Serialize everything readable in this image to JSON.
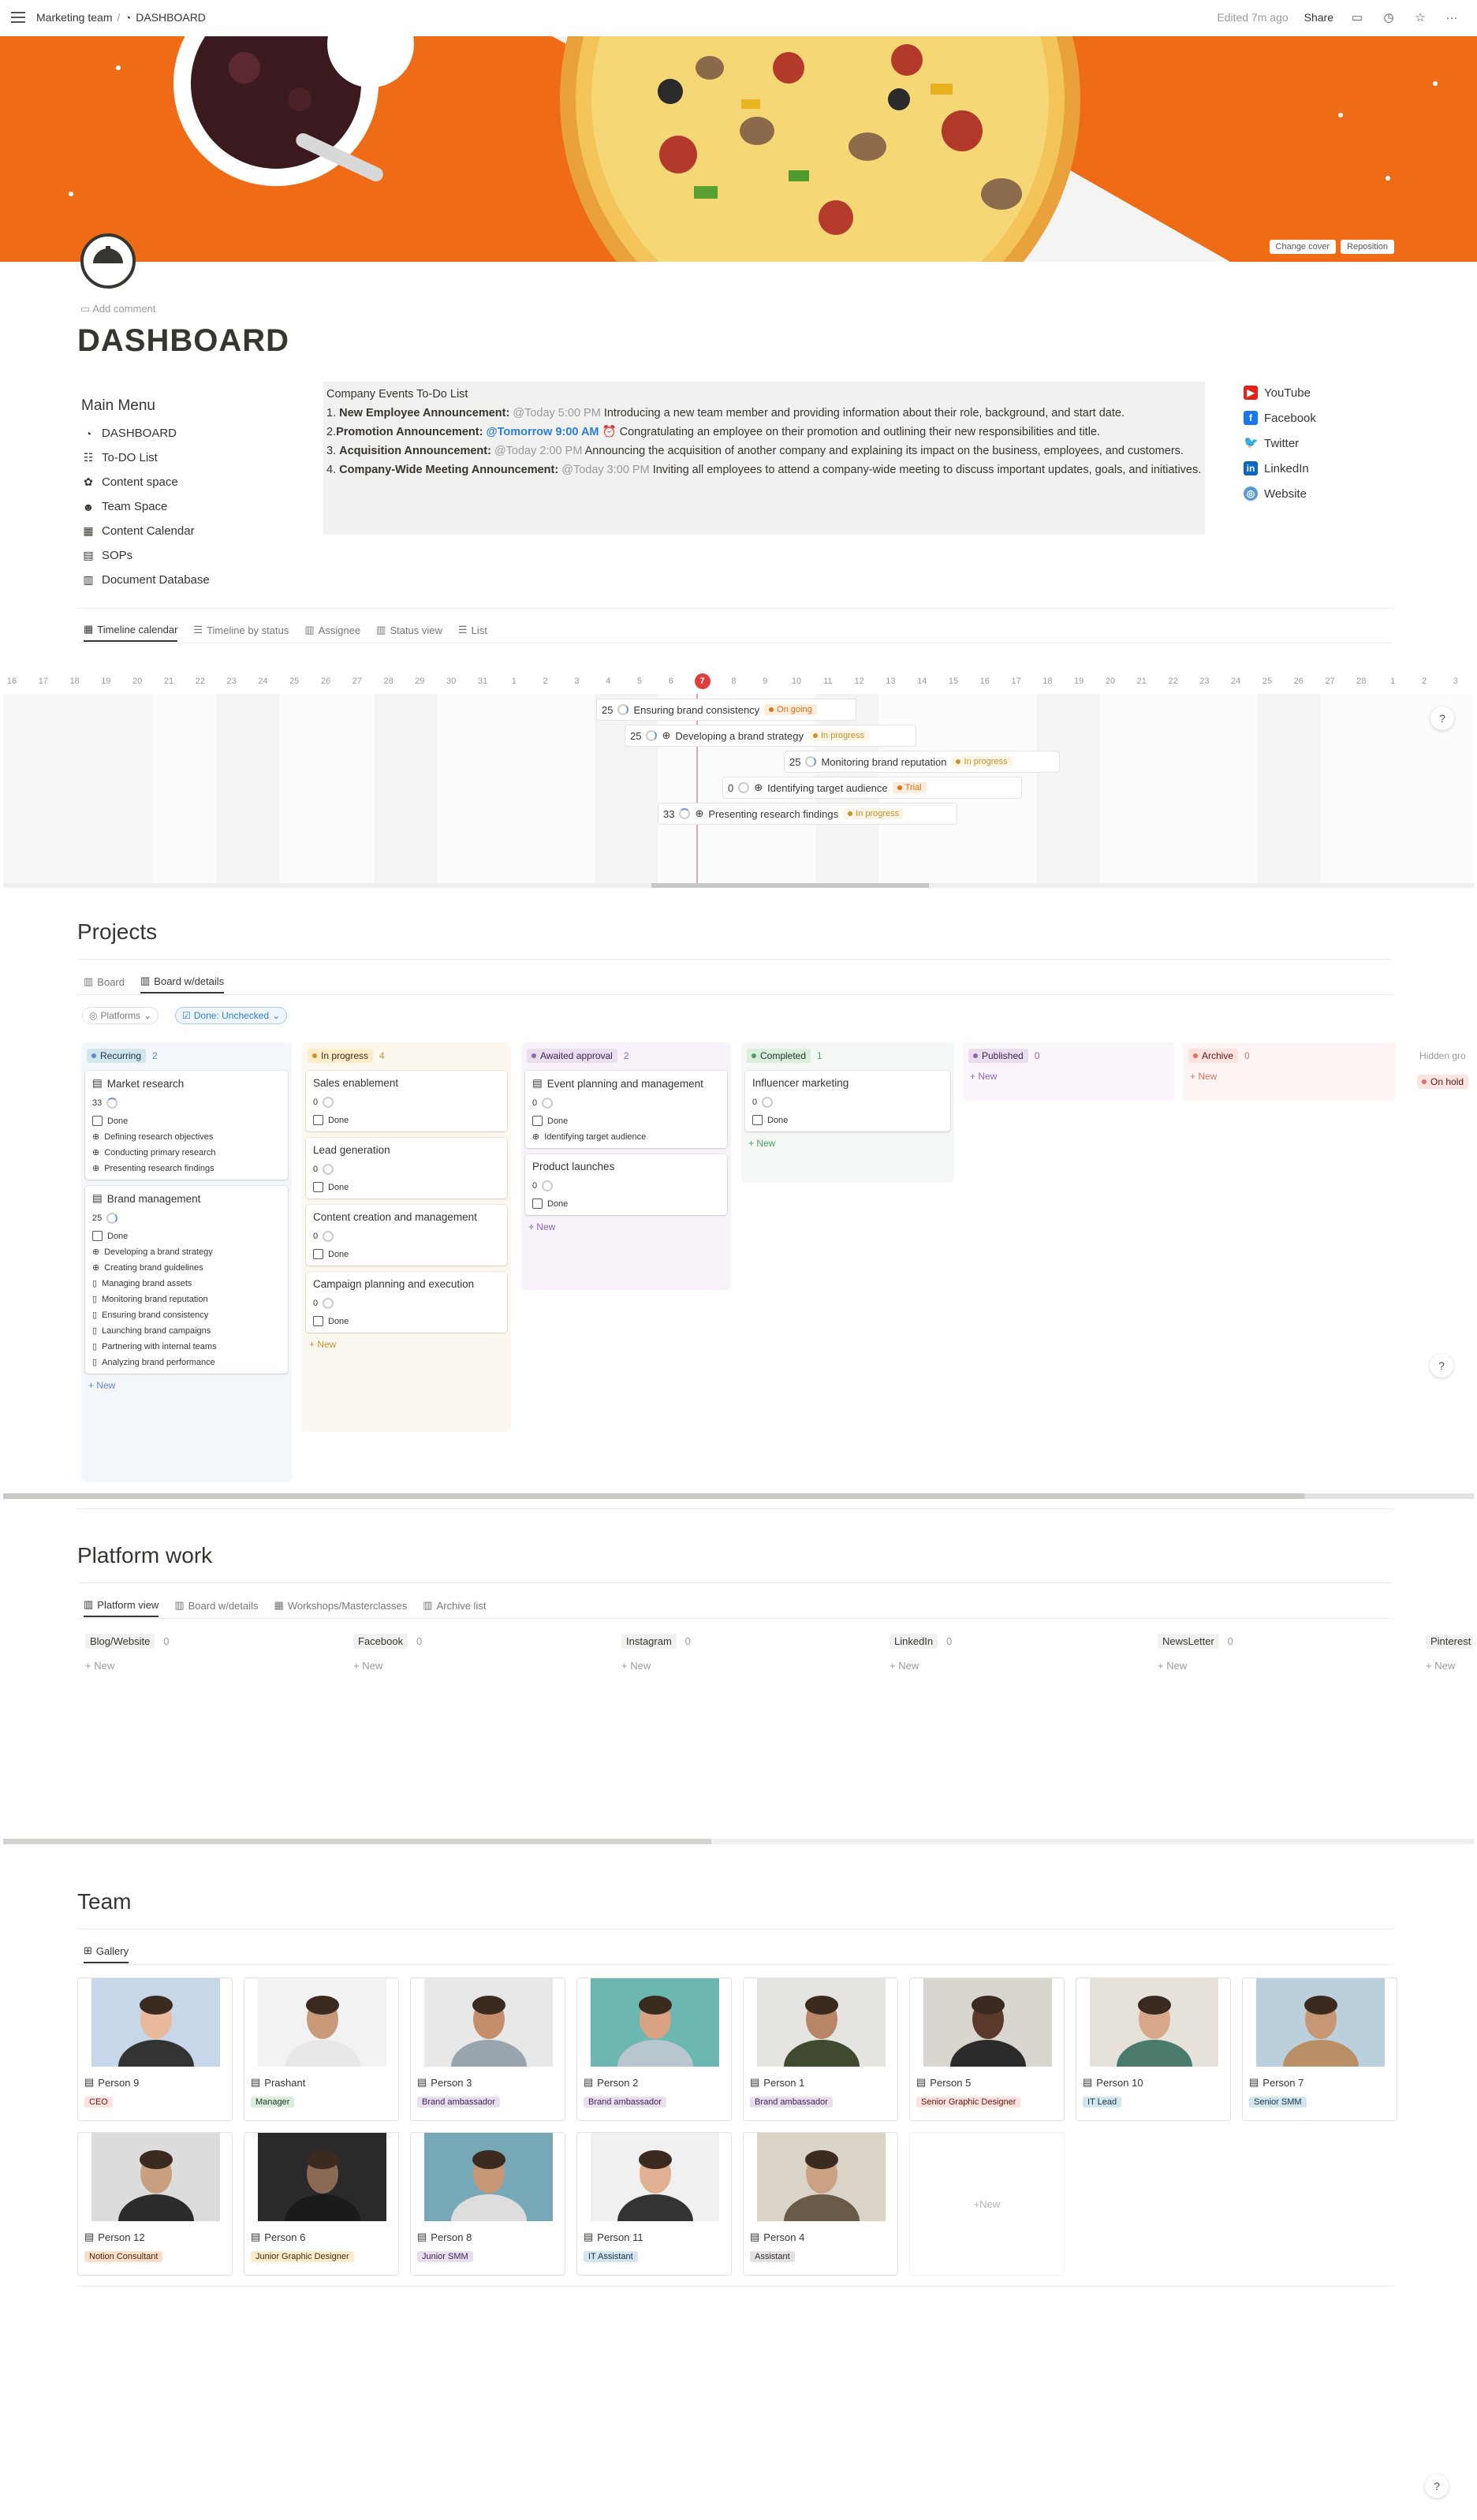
{
  "topbar": {
    "workspace": "Marketing team",
    "separator": "/",
    "page": "DASHBOARD",
    "edited": "Edited 7m ago",
    "share": "Share"
  },
  "cover": {
    "change": "Change cover",
    "reposition": "Reposition"
  },
  "page": {
    "add_comment": "Add comment",
    "title": "DASHBOARD"
  },
  "main_menu": {
    "heading": "Main Menu",
    "items": [
      "DASHBOARD",
      "To-DO List",
      "Content space",
      "Team Space",
      "Content Calendar",
      "SOPs",
      "Document Database"
    ]
  },
  "events": {
    "heading": "Company Events To-Do List",
    "items": [
      {
        "num": "1. ",
        "title": "New Employee Announcement:",
        "when": "@Today 5:00 PM",
        "text": "Introducing a new team member and providing information about their role, background, and start date."
      },
      {
        "num": "2.",
        "title": "Promotion Announcement:",
        "when": "@Tomorrow 9:00 AM",
        "text": "Congratulating an employee on their promotion and outlining their new responsibilities and title."
      },
      {
        "num": "3. ",
        "title": "Acquisition Announcement:",
        "when": "@Today 2:00 PM",
        "text": "Announcing the acquisition of another company and explaining its impact on the business, employees, and customers."
      },
      {
        "num": "4. ",
        "title": "Company-Wide Meeting Announcement:",
        "when": "@Today 3:00 PM",
        "text": "Inviting all employees to attend a company-wide meeting to discuss important updates, goals, and initiatives."
      }
    ]
  },
  "social": [
    "YouTube",
    "Facebook",
    "Twitter",
    "LinkedIn",
    "Website"
  ],
  "timeline_tabs": [
    "Timeline calendar",
    "Timeline by status",
    "Assignee",
    "Status view",
    "List"
  ],
  "timeline": {
    "days": [
      "16",
      "17",
      "18",
      "19",
      "20",
      "21",
      "22",
      "23",
      "24",
      "25",
      "26",
      "27",
      "28",
      "29",
      "30",
      "31",
      "1",
      "2",
      "3",
      "4",
      "5",
      "6",
      "7",
      "8",
      "9",
      "10",
      "11",
      "12",
      "13",
      "14",
      "15",
      "16",
      "17",
      "18",
      "19",
      "20",
      "21",
      "22",
      "23",
      "24",
      "25",
      "26",
      "27",
      "28",
      "1",
      "2",
      "3"
    ],
    "today": "7",
    "bars": [
      {
        "num": "25",
        "name": "Ensuring brand consistency",
        "status": "On going"
      },
      {
        "num": "25",
        "name": "Developing a brand strategy",
        "status": "In progress"
      },
      {
        "num": "25",
        "name": "Monitoring brand reputation",
        "status": "In progress"
      },
      {
        "num": "0",
        "name": "Identifying target audience",
        "status": "Trial"
      },
      {
        "num": "33",
        "name": "Presenting research findings",
        "status": "In progress"
      }
    ]
  },
  "projects": {
    "heading": "Projects",
    "tabs": [
      "Board",
      "Board w/details"
    ],
    "filters": {
      "platforms": "Platforms",
      "done": "Done: Unchecked"
    },
    "columns": [
      {
        "name": "Recurring",
        "count": "2"
      },
      {
        "name": "In progress",
        "count": "4"
      },
      {
        "name": "Awaited approval",
        "count": "2"
      },
      {
        "name": "Completed",
        "count": "1"
      },
      {
        "name": "Published",
        "count": "0"
      },
      {
        "name": "Archive",
        "count": "0"
      }
    ],
    "hidden": "Hidden gro",
    "on_hold": "On hold",
    "done_label": "Done",
    "new_label": "New",
    "cards": {
      "market": {
        "title": "Market research",
        "num": "33",
        "rels": [
          "Defining research objectives",
          "Conducting primary research",
          "Presenting research findings"
        ]
      },
      "brand": {
        "title": "Brand management",
        "num": "25",
        "rels": [
          "Developing a brand strategy",
          "Creating brand guidelines",
          "Managing brand assets",
          "Monitoring brand reputation",
          "Ensuring brand consistency",
          "Launching brand campaigns",
          "Partnering with internal teams",
          "Analyzing brand performance"
        ]
      },
      "inprog": [
        {
          "title": "Sales enablement",
          "num": "0"
        },
        {
          "title": "Lead generation",
          "num": "0"
        },
        {
          "title": "Content creation and management",
          "num": "0"
        },
        {
          "title": "Campaign planning and execution",
          "num": "0"
        }
      ],
      "event": {
        "title": "Event planning and management",
        "num": "0",
        "rel": "Identifying target audience"
      },
      "product": {
        "title": "Product launches",
        "num": "0"
      },
      "influencer": {
        "title": "Influencer marketing",
        "num": "0"
      }
    }
  },
  "platform": {
    "heading": "Platform work",
    "tabs": [
      "Platform view",
      "Board w/details",
      "Workshops/Masterclasses",
      "Archive list"
    ],
    "columns": [
      {
        "name": "Blog/Website",
        "count": "0"
      },
      {
        "name": "Facebook",
        "count": "0"
      },
      {
        "name": "Instagram",
        "count": "0"
      },
      {
        "name": "LinkedIn",
        "count": "0"
      },
      {
        "name": "NewsLetter",
        "count": "0"
      },
      {
        "name": "Pinterest",
        "count": ""
      }
    ]
  },
  "team": {
    "heading": "Team",
    "tab": "Gallery",
    "new_label": "New",
    "people": [
      {
        "name": "Person 9",
        "role": "CEO"
      },
      {
        "name": "Prashant",
        "role": "Manager"
      },
      {
        "name": "Person 3",
        "role": "Brand ambassador"
      },
      {
        "name": "Person 2",
        "role": "Brand ambassador"
      },
      {
        "name": "Person 1",
        "role": "Brand ambassador"
      },
      {
        "name": "Person 5",
        "role": "Senior Graphic Designer"
      },
      {
        "name": "Person 10",
        "role": "IT Lead"
      },
      {
        "name": "Person 7",
        "role": "Senior SMM"
      },
      {
        "name": "Person 12",
        "role": "Notion Consultant"
      },
      {
        "name": "Person 6",
        "role": "Junior Graphic Designer"
      },
      {
        "name": "Person 8",
        "role": "Junior SMM"
      },
      {
        "name": "Person 11",
        "role": "IT Assistant"
      },
      {
        "name": "Person 4",
        "role": "Assistant"
      }
    ]
  },
  "help": "?",
  "colors": {
    "accent": "#2e7dd6",
    "cover": "#ee6a14",
    "today": "#e03e3e"
  }
}
